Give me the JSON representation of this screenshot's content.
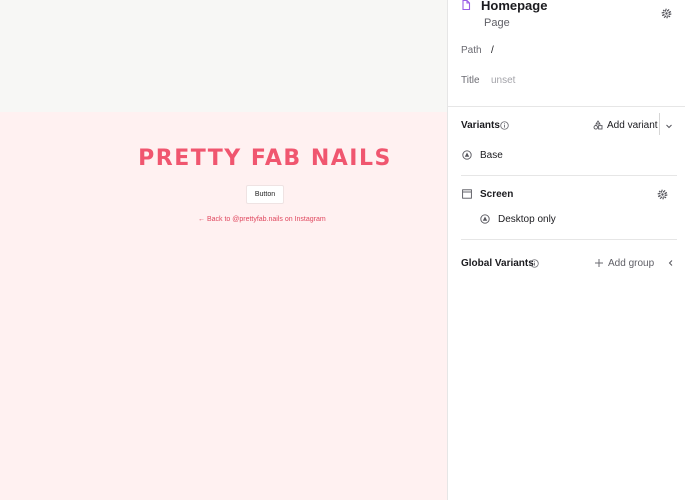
{
  "canvas": {
    "brand_title": "PRETTY FAB NAILS",
    "button_label": "Button",
    "back_link": "← Back to @prettyfab.nails on Instagram"
  },
  "panel": {
    "page_title": "Homepage",
    "page_type": "Page",
    "path_label": "Path",
    "path_value": "/",
    "title_label": "Title",
    "title_placeholder": "unset",
    "variants": {
      "title": "Variants",
      "add_label": "Add variant",
      "base_label": "Base"
    },
    "screen": {
      "title": "Screen",
      "item_label": "Desktop only"
    },
    "global_variants": {
      "title": "Global Variants",
      "add_label": "Add group"
    }
  },
  "colors": {
    "brand_pink": "#f0566f",
    "artboard_bg": "#fff1f1",
    "canvas_bg": "#f7f7f5",
    "page_icon": "#9b5de5"
  }
}
